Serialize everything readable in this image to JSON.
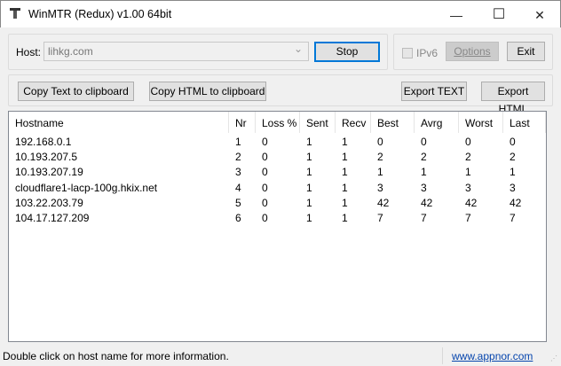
{
  "window": {
    "title": "WinMTR (Redux) v1.00 64bit",
    "minimize": "—",
    "maximize": "☐",
    "close": "✕"
  },
  "host": {
    "label": "Host:",
    "value": "lihkg.com",
    "dropdown": "⌄"
  },
  "buttons": {
    "stop": "Stop",
    "ipv6": "IPv6",
    "options": "Options",
    "exit": "Exit",
    "copy_text": "Copy Text to clipboard",
    "copy_html": "Copy HTML to clipboard",
    "export_text": "Export TEXT",
    "export_html": "Export HTML"
  },
  "table": {
    "columns": [
      "Hostname",
      "Nr",
      "Loss %",
      "Sent",
      "Recv",
      "Best",
      "Avrg",
      "Worst",
      "Last"
    ],
    "rows": [
      [
        "192.168.0.1",
        "1",
        "0",
        "1",
        "1",
        "0",
        "0",
        "0",
        "0"
      ],
      [
        "10.193.207.5",
        "2",
        "0",
        "1",
        "1",
        "2",
        "2",
        "2",
        "2"
      ],
      [
        "10.193.207.19",
        "3",
        "0",
        "1",
        "1",
        "1",
        "1",
        "1",
        "1"
      ],
      [
        "cloudflare1-lacp-100g.hkix.net",
        "4",
        "0",
        "1",
        "1",
        "3",
        "3",
        "3",
        "3"
      ],
      [
        "103.22.203.79",
        "5",
        "0",
        "1",
        "1",
        "42",
        "42",
        "42",
        "42"
      ],
      [
        "104.17.127.209",
        "6",
        "0",
        "1",
        "1",
        "7",
        "7",
        "7",
        "7"
      ]
    ]
  },
  "status": {
    "message": "Double click on host name for more information.",
    "link": "www.appnor.com"
  },
  "colors": {
    "accent": "#0078d7",
    "link": "#0645ad"
  }
}
